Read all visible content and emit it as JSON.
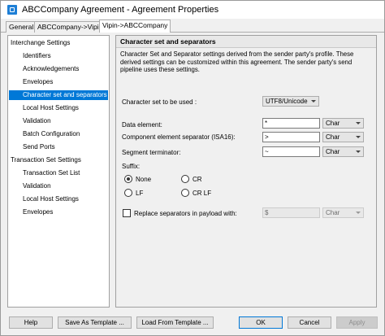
{
  "window": {
    "title": "ABCCompany Agreement - Agreement Properties"
  },
  "tabs": [
    {
      "label": "General"
    },
    {
      "label": "ABCCompany->Vipin"
    },
    {
      "label": "Vipin->ABCCompany"
    }
  ],
  "tree": {
    "items": [
      {
        "label": "Interchange Settings"
      },
      {
        "label": "Identifiers"
      },
      {
        "label": "Acknowledgements"
      },
      {
        "label": "Envelopes"
      },
      {
        "label": "Character set and separators"
      },
      {
        "label": "Local Host Settings"
      },
      {
        "label": "Validation"
      },
      {
        "label": "Batch Configuration"
      },
      {
        "label": "Send Ports"
      },
      {
        "label": "Transaction Set Settings"
      },
      {
        "label": "Transaction Set List"
      },
      {
        "label": "Validation"
      },
      {
        "label": "Local Host Settings"
      },
      {
        "label": "Envelopes"
      }
    ]
  },
  "panel": {
    "header": "Character set and separators",
    "description": "Character Set and Separator settings derived from the sender party's profile. These derived settings can be customized within this agreement. The sender party's send pipeline uses these settings.",
    "charset": {
      "label": "Character set to be used :",
      "value": "UTF8/Unicode"
    },
    "data_element": {
      "label": "Data element:",
      "value": "*",
      "type": "Char"
    },
    "component_separator": {
      "label": "Component element separator (ISA16):",
      "value": ">",
      "type": "Char"
    },
    "segment_terminator": {
      "label": "Segment terminator:",
      "value": "~",
      "type": "Char"
    },
    "suffix": {
      "label": "Suffix:",
      "options": [
        {
          "label": "None",
          "checked": true
        },
        {
          "label": "CR",
          "checked": false
        },
        {
          "label": "LF",
          "checked": false
        },
        {
          "label": "CR LF",
          "checked": false
        }
      ]
    },
    "replace": {
      "label": "Replace separators in payload with:",
      "value": "$",
      "type": "Char",
      "checked": false
    }
  },
  "buttons": {
    "help": "Help",
    "save_template": "Save As Template ...",
    "load_template": "Load From Template ...",
    "ok": "OK",
    "cancel": "Cancel",
    "apply": "Apply"
  }
}
